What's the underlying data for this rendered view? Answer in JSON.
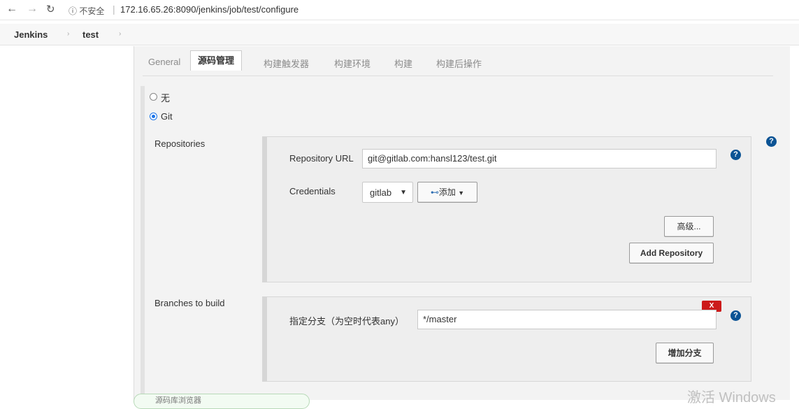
{
  "browser": {
    "back_icon": "arrow-left-icon",
    "forward_icon": "arrow-right-icon",
    "reload_icon": "reload-icon",
    "security_text": "ⓘ 不安全",
    "url": "172.16.65.26:8090/jenkins/job/test/configure"
  },
  "breadcrumb": {
    "items": [
      "Jenkins",
      "test"
    ]
  },
  "tabs": [
    "General",
    "源码管理",
    "构建触发器",
    "构建环境",
    "构建",
    "构建后操作"
  ],
  "active_tab": "源码管理",
  "scm": {
    "option_none": "无",
    "option_git": "Git",
    "selected": "Git"
  },
  "repositories": {
    "label": "Repositories",
    "url_label": "Repository URL",
    "url_value": "git@gitlab.com:hansl123/test.git",
    "credentials_label": "Credentials",
    "credentials_value": "gitlab",
    "add_label": "添加",
    "advanced_label": "高级...",
    "add_repository_label": "Add Repository"
  },
  "branches": {
    "label": "Branches to build",
    "branch_label": "指定分支（为空时代表any）",
    "branch_value": "*/master",
    "delete_label": "X",
    "add_branch_label": "增加分支"
  },
  "help_symbol": "?",
  "bottom_pill_text": "源码库浏览器",
  "watermark": "激活 Windows",
  "colors": {
    "help": "#0b5394",
    "delete": "#cc1a1a",
    "radio": "#1a73e8"
  }
}
